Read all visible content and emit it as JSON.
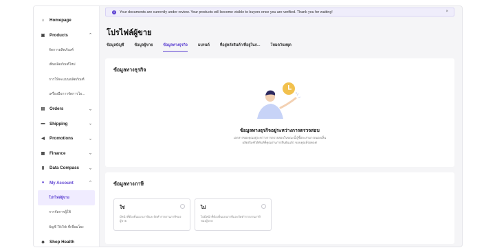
{
  "sidebar": {
    "items": [
      {
        "label": "Homepage",
        "icon": "home-icon"
      },
      {
        "label": "Products",
        "icon": "box-icon"
      },
      {
        "label": "Orders",
        "icon": "orders-icon"
      },
      {
        "label": "Shipping",
        "icon": "truck-icon"
      },
      {
        "label": "Promotions",
        "icon": "megaphone-icon"
      },
      {
        "label": "Finance",
        "icon": "finance-icon"
      },
      {
        "label": "Data Compass",
        "icon": "chart-icon"
      },
      {
        "label": "My Account",
        "icon": "user-icon"
      },
      {
        "label": "Shop Health",
        "icon": "shield-icon"
      }
    ],
    "products_sub": [
      "จัดการผลิตภัณฑ์",
      "เพิ่มผลิตภัณฑ์ใหม่",
      "การให้คะแนนผลิตภัณฑ์",
      "เครื่องมือการจัดการไอ..."
    ],
    "account_sub": [
      "โปรไฟล์ผู้ขาย",
      "การจัดการผู้ใช้",
      "บัญชี TikTok ที่เชื่อมโยง"
    ]
  },
  "banner": {
    "text": "Your documents are currently under review. Your products will become visible to buyers once you are verified. Thank you for waiting!",
    "close": "×"
  },
  "page": {
    "title": "โปรไฟล์ผู้ขาย",
    "tabs": [
      "ข้อมูลบัญชี",
      "ข้อมูลผู้ขาย",
      "ข้อมูลทางธุรกิจ",
      "แบรนด์",
      "ที่อยู่คลังสินค้า/ที่อยู่ในก...",
      "โหมดวันหยุด"
    ],
    "active_tab_index": 2
  },
  "business_info": {
    "title": "ข้อมูลทางธุรกิจ",
    "status_title": "ข้อมูลทางธุรกิจอยู่ระหว่างการตรวจสอบ",
    "status_desc": "เอกสารของคุณอยู่ระหว่างการตรวจสอบในขณะนี้ ผู้ซื้อจะสามารถมองเห็นผลิตภัณฑ์ได้ทันทีที่คุณผ่านการยืนยันแล้ว ขอบคุณที่รอคอย!"
  },
  "tax_info": {
    "title": "ข้อมูลทางภาษี",
    "options": [
      {
        "label": "ใช่",
        "desc": "มีหน้าที่ต้องยื่นแบบภาษีและจัดทำรายงานภาษีของผู้ขาย"
      },
      {
        "label": "ไม่",
        "desc": "ไม่มีหน้าที่ต้องยื่นแบบภาษีและจัดทำรายงานภาษีของผู้ขาย"
      }
    ]
  },
  "colors": {
    "accent": "#5b3fd1",
    "illustration_sun": "#f2c14e"
  }
}
